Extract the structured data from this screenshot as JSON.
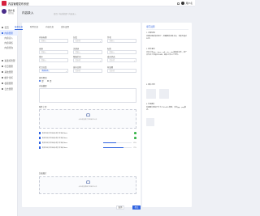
{
  "app": {
    "title": "内容管理发布系统",
    "user": "用户名"
  },
  "sidebar": {
    "profile_name": "用户名",
    "profile_role": "管理员",
    "items": [
      {
        "label": "首页"
      },
      {
        "label": "内容管理"
      },
      {
        "label": "内容录入"
      },
      {
        "label": "内容审核"
      },
      {
        "label": "内容查询"
      },
      {
        "label": "资源库管理"
      },
      {
        "label": "栏目管理"
      },
      {
        "label": "系统管理"
      },
      {
        "label": "统计分析"
      },
      {
        "label": "权限管理"
      },
      {
        "label": "日志管理"
      }
    ]
  },
  "page": {
    "title": "内容录入",
    "breadcrumb": "首页 / 内容管理 / 内容录入"
  },
  "tabs": [
    {
      "label": "基本信息"
    },
    {
      "label": "附件信息"
    },
    {
      "label": "内容信息"
    },
    {
      "label": "发布设置"
    }
  ],
  "form": {
    "fields": [
      {
        "label": "内容标题",
        "placeholder": "请输入"
      },
      {
        "label": "分类",
        "placeholder": "请选择"
      },
      {
        "label": "作者",
        "placeholder": "请输入"
      },
      {
        "label": "来源",
        "placeholder": "请输入"
      },
      {
        "label": "关键词",
        "placeholder": "请输入"
      },
      {
        "label": "标签",
        "placeholder": "请输入"
      },
      {
        "label": "排序",
        "placeholder": "请输入"
      },
      {
        "label": "所属栏目",
        "placeholder": "请选择"
      },
      {
        "label": "发布状态",
        "placeholder": "请选择"
      },
      {
        "label": "栏目分类",
        "tag": "新闻动态"
      },
      {
        "label": "发布日期",
        "placeholder": "请选择"
      },
      {
        "label": "有效期",
        "placeholder": "请选择"
      }
    ],
    "radio_label": "是否置顶",
    "radio_yes": "是",
    "radio_no": "否",
    "summary_label": "内容摘要",
    "attachment_label": "附件上传",
    "upload_hint": "点击或拖拽文件到此处上传",
    "files": [
      {
        "name": "附件资料文件名称示例文件名称.docx",
        "status": "done"
      },
      {
        "name": "附件资料文件名称示例文件名称.docx",
        "status": "done"
      },
      {
        "name": "附件资料文件名称示例文件名称.docx",
        "status": "uploading",
        "progress": 0.45,
        "progress_text": "45%"
      },
      {
        "name": "附件资料文件名称示例文件名称.docx",
        "status": "uploading",
        "progress": 0.72,
        "progress_text": "72%"
      }
    ],
    "cover_label": "封面图片",
    "cover_hint": "点击或拖拽图片到此处上传",
    "cancel": "取消",
    "submit": "提交"
  },
  "panel": {
    "title": "填写说明",
    "p1": "1. 内容标题",
    "p2": "内容标题应简洁明了，准确概括内容主旨，长度不超过50字。",
    "p3": "2. 附件要求",
    "p4": "支持上传doc、docx、pdf、xls、xlsx等格式文件，单个文件大小不超过20MB，最多上传10个附件。",
    "p5": "3. 图片示例",
    "p6": "4. 封面图片",
    "p7": "封面图片建议尺寸为 750×420 像素，支持jpg、png格式。"
  },
  "colors": {
    "accent": "#2f63e0",
    "brand": "#d61f3c",
    "success": "#39b54a"
  }
}
